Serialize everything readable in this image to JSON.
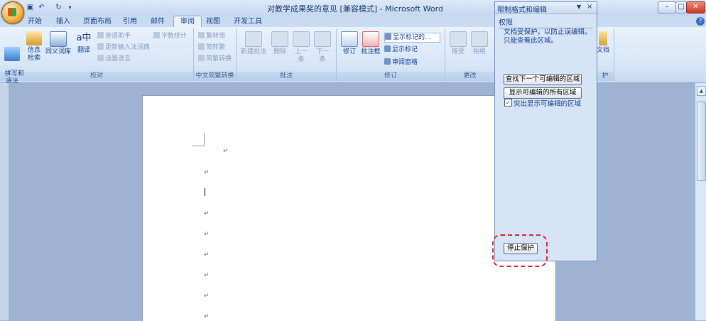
{
  "window": {
    "title": "对教学成果奖的意见 [兼容模式] - Microsoft Word",
    "controls": {
      "minimize": "–",
      "maximize": "□",
      "close": "✕"
    }
  },
  "tabs": [
    {
      "label": "开始"
    },
    {
      "label": "插入"
    },
    {
      "label": "页面布局"
    },
    {
      "label": "引用"
    },
    {
      "label": "邮件"
    },
    {
      "label": "审阅",
      "active": true
    },
    {
      "label": "视图"
    },
    {
      "label": "开发工具"
    }
  ],
  "ribbon": {
    "proofing": {
      "label": "校对",
      "spelling": "拼写和\n语法",
      "research": "信息\n检索",
      "thesaurus": "同义词库",
      "translate": "翻译",
      "english_assistant": "英语助手",
      "update_ime": "更新输入法词典",
      "set_language": "设置语言",
      "word_count": "字数统计"
    },
    "chinese": {
      "label": "中文简繁转换",
      "to_simplified": "繁转简",
      "to_traditional": "简转繁",
      "convert": "简繁转换"
    },
    "comments": {
      "label": "批注",
      "new": "新建批注",
      "delete": "删除",
      "previous": "上一\n条",
      "next": "下一\n条"
    },
    "tracking": {
      "label": "修订",
      "track_changes": "修订",
      "balloons": "批注框",
      "display_dropdown": "显示标记的...",
      "show_markup": "显示标记",
      "reviewing_pane": "审阅窗格"
    },
    "changes": {
      "label": "更改",
      "accept": "接受",
      "reject": "拒绝"
    },
    "protect": {
      "label": "护",
      "document": "文档"
    }
  },
  "task_pane": {
    "title": "限制格式和编辑",
    "section": "权限",
    "message_line1": "文档受保护，以防止误编辑。",
    "message_line2": "只能查看此区域。",
    "find_next_button": "查找下一个可编辑的区域",
    "show_all_button": "显示可编辑的所有区域",
    "highlight_checkbox": {
      "label": "突出显示可编辑的区域",
      "checked": true,
      "mark": "✓"
    },
    "stop_protection_button": "停止保护"
  },
  "document": {
    "paragraph_mark": "↵"
  },
  "colors": {
    "accent": "#15428b",
    "ribbon_bg": "#dbe8f7",
    "highlight_ring": "#d22a2a"
  },
  "icons": {
    "office_button": "office-logo-icon",
    "save": "save-icon",
    "undo": "undo-icon",
    "redo": "redo-icon",
    "help": "help-icon"
  }
}
